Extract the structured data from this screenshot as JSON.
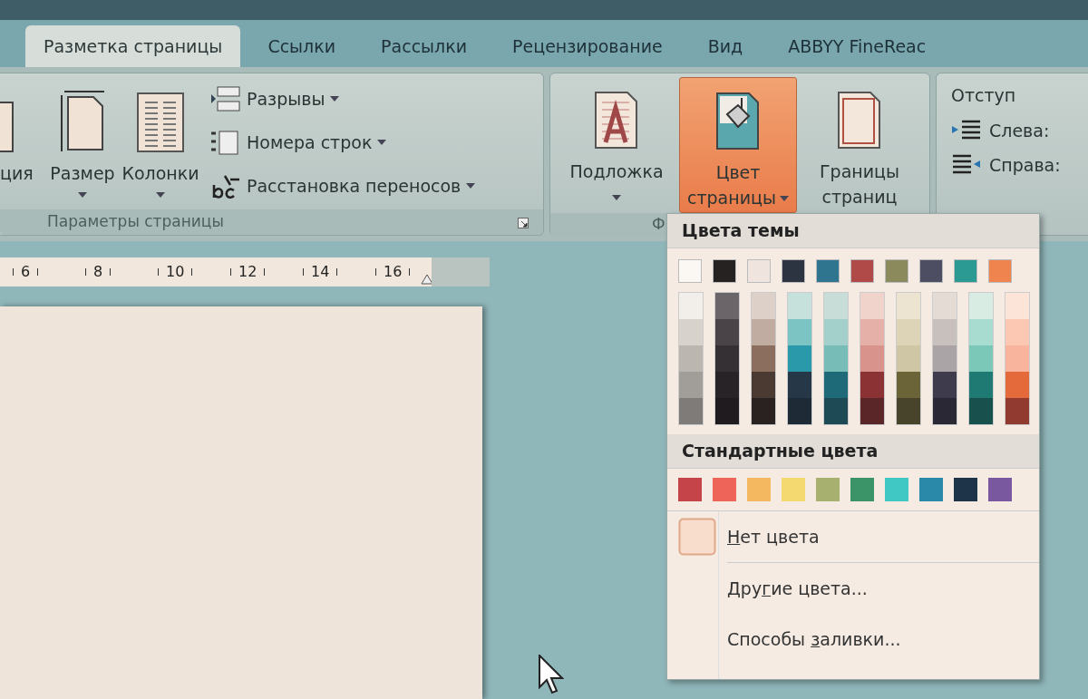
{
  "tabs": [
    {
      "label": "Разметка страницы",
      "selected": true
    },
    {
      "label": "Ссылки",
      "selected": false
    },
    {
      "label": "Рассылки",
      "selected": false
    },
    {
      "label": "Рецензирование",
      "selected": false
    },
    {
      "label": "Вид",
      "selected": false
    },
    {
      "label": "ABBYY FineReac",
      "selected": false
    }
  ],
  "page_setup_group": {
    "label": "Параметры страницы",
    "large_buttons": [
      {
        "label": "ция",
        "dropdown": false
      },
      {
        "label": "Размер",
        "dropdown": true
      },
      {
        "label": "Колонки",
        "dropdown": true
      }
    ],
    "small_buttons": [
      {
        "label": "Разрывы"
      },
      {
        "label": "Номера строк"
      },
      {
        "label": "Расстановка переносов"
      }
    ]
  },
  "page_background_group": {
    "label": "Ф",
    "buttons": [
      {
        "line_1": "Подложка",
        "dropdown": true,
        "pressed": false
      },
      {
        "line_1": "Цвет",
        "line_2": "страницы",
        "dropdown": true,
        "pressed": true
      },
      {
        "line_1": "Границы",
        "line_2": "страниц",
        "dropdown": false,
        "pressed": false
      }
    ]
  },
  "paragraph_group": {
    "title": "Отступ",
    "rows": [
      {
        "label": "Слева:"
      },
      {
        "label": "Справа:"
      }
    ]
  },
  "ruler": {
    "numbers": [
      "6",
      "8",
      "10",
      "12",
      "14",
      "16"
    ]
  },
  "color_menu": {
    "theme_header": "Цвета темы",
    "theme_colors": [
      {
        "color": "#fbf7f2"
      },
      {
        "color": "#262222"
      },
      {
        "color": "#efe5de"
      },
      {
        "color": "#2b3440"
      },
      {
        "color": "#2f7590"
      },
      {
        "color": "#b04a48"
      },
      {
        "color": "#8a8a5c"
      },
      {
        "color": "#4e4e62"
      },
      {
        "color": "#2a9a92"
      },
      {
        "color": "#f0844e"
      }
    ],
    "shade_columns": [
      {
        "shades": [
          {
            "color": "#f2eeea"
          },
          {
            "color": "#d8d2cd"
          },
          {
            "color": "#bcb6b1"
          },
          {
            "color": "#a19d98"
          },
          {
            "color": "#7f7b78"
          }
        ]
      },
      {
        "shades": [
          {
            "color": "#6b6468"
          },
          {
            "color": "#4a4448"
          },
          {
            "color": "#353034"
          },
          {
            "color": "#272326"
          },
          {
            "color": "#1f1b1e"
          }
        ]
      },
      {
        "shades": [
          {
            "color": "#ddd0c8"
          },
          {
            "color": "#c0aca0"
          },
          {
            "color": "#8c6e5e"
          },
          {
            "color": "#4a3a32"
          },
          {
            "color": "#2a2220"
          }
        ]
      },
      {
        "shades": [
          {
            "color": "#c6e0dc"
          },
          {
            "color": "#7cc4c4"
          },
          {
            "color": "#2a9aaa"
          },
          {
            "color": "#263848"
          },
          {
            "color": "#1e2a36"
          }
        ]
      },
      {
        "shades": [
          {
            "color": "#c8dcd8"
          },
          {
            "color": "#a4d0cc"
          },
          {
            "color": "#78bcb8"
          },
          {
            "color": "#1f6a78"
          },
          {
            "color": "#1e4a56"
          }
        ]
      },
      {
        "shades": [
          {
            "color": "#f0d4cc"
          },
          {
            "color": "#e4b0a8"
          },
          {
            "color": "#d8948c"
          },
          {
            "color": "#8a3234"
          },
          {
            "color": "#5a2628"
          }
        ]
      },
      {
        "shades": [
          {
            "color": "#ece4d0"
          },
          {
            "color": "#ddd4b8"
          },
          {
            "color": "#cec6a4"
          },
          {
            "color": "#6a6438"
          },
          {
            "color": "#48442c"
          }
        ]
      },
      {
        "shades": [
          {
            "color": "#e4dcd4"
          },
          {
            "color": "#c8c0bc"
          },
          {
            "color": "#aaa4a6"
          },
          {
            "color": "#3e3c4c"
          },
          {
            "color": "#2a2834"
          }
        ]
      },
      {
        "shades": [
          {
            "color": "#d8ece4"
          },
          {
            "color": "#a8dcd0"
          },
          {
            "color": "#7cc8b8"
          },
          {
            "color": "#1e7a72"
          },
          {
            "color": "#17504c"
          }
        ]
      },
      {
        "shades": [
          {
            "color": "#fce4d8"
          },
          {
            "color": "#fcc8b4"
          },
          {
            "color": "#f8b49c"
          },
          {
            "color": "#e46a3c"
          },
          {
            "color": "#903a30"
          }
        ]
      }
    ],
    "standard_header": "Стандартные цвета",
    "standard_colors": [
      {
        "color": "#c4444a"
      },
      {
        "color": "#ee6458"
      },
      {
        "color": "#f4b860"
      },
      {
        "color": "#f4d870"
      },
      {
        "color": "#a8b070"
      },
      {
        "color": "#3a9468"
      },
      {
        "color": "#40c8c4"
      },
      {
        "color": "#2a88a8"
      },
      {
        "color": "#1e3448"
      },
      {
        "color": "#7a58a0"
      }
    ],
    "items": [
      {
        "kind": "no-color",
        "key": "Н",
        "post": "ет цвета"
      },
      {
        "kind": "more-colors",
        "pre": "Дру",
        "key": "г",
        "post": "ие цвета..."
      },
      {
        "kind": "fill-effects",
        "pre": "Способы ",
        "key": "з",
        "post": "аливки..."
      }
    ]
  }
}
